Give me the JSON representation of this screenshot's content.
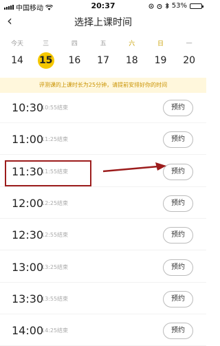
{
  "status_bar": {
    "carrier": "中国移动",
    "time": "20:37",
    "battery": "53%",
    "battery_level": 0.53
  },
  "nav": {
    "back_glyph": "‹",
    "title": "选择上课时间"
  },
  "week_days": [
    {
      "label": "今天",
      "weekend": false
    },
    {
      "label": "三",
      "weekend": false
    },
    {
      "label": "四",
      "weekend": false
    },
    {
      "label": "五",
      "weekend": false
    },
    {
      "label": "六",
      "weekend": true
    },
    {
      "label": "日",
      "weekend": true
    },
    {
      "label": "一",
      "weekend": false
    }
  ],
  "dates": [
    "14",
    "15",
    "16",
    "17",
    "18",
    "19",
    "20"
  ],
  "selected_date": "15",
  "notice": "评测课的上课时长为25分钟，请提前安排好你的时间",
  "slots": [
    {
      "time": "10:30",
      "end": "10:55结束",
      "button": "预约"
    },
    {
      "time": "11:00",
      "end": "11:25结束",
      "button": "预约"
    },
    {
      "time": "11:30",
      "end": "11:55结束",
      "button": "预约"
    },
    {
      "time": "12:00",
      "end": "12:25结束",
      "button": "预约"
    },
    {
      "time": "12:30",
      "end": "12:55结束",
      "button": "预约"
    },
    {
      "time": "13:00",
      "end": "13:25结束",
      "button": "预约"
    },
    {
      "time": "13:30",
      "end": "13:55结束",
      "button": "预约"
    },
    {
      "time": "14:00",
      "end": "14:25结束",
      "button": "预约"
    }
  ],
  "colors": {
    "accent": "#f5c700",
    "notice_bg": "#fff7dc",
    "notice_text": "#c99200",
    "annotation": "#9c1c1c"
  }
}
